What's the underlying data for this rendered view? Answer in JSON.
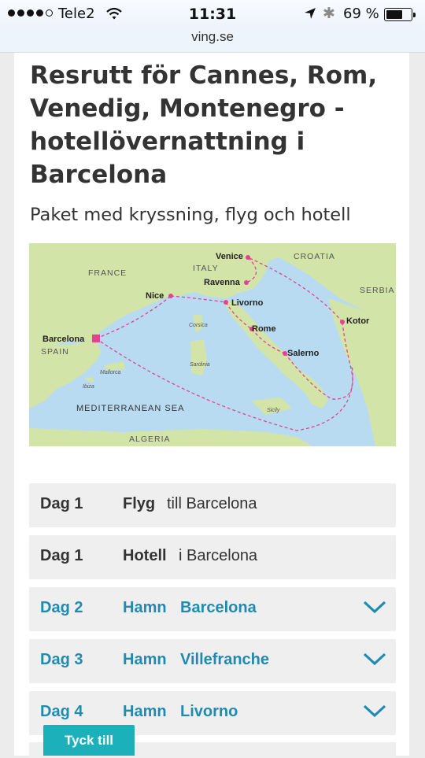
{
  "status_bar": {
    "carrier": "Tele2",
    "time": "11:31",
    "battery": "69 %",
    "battery_level": 0.69,
    "icons": [
      "signal-icon",
      "wifi-icon",
      "location-icon",
      "bluetooth-icon",
      "battery-icon"
    ]
  },
  "browser": {
    "url": "ving.se"
  },
  "page": {
    "title": "Resrutt för Cannes, Rom, Venedig, Montenegro - hotellövernattning i Barcelona",
    "subtitle": "Paket med kryssning, flyg och hotell"
  },
  "map": {
    "countries": [
      "FRANCE",
      "ITALY",
      "CROATIA",
      "SERBIA",
      "SPAIN",
      "ALGERIA"
    ],
    "sea": "MEDITERRANEAN SEA",
    "islands": [
      "Corsica",
      "Sardinia",
      "Mallorca",
      "Ibiza",
      "Sicily"
    ],
    "ports": [
      "Venice",
      "Ravenna",
      "Nice",
      "Livorno",
      "Barcelona",
      "Rome",
      "Salerno",
      "Kotor"
    ],
    "colors": {
      "sea": "#b9dbf1",
      "land": "#d3e4a8",
      "route": "#e0458e"
    }
  },
  "itinerary": [
    {
      "day": "Dag 1",
      "kind": "Flyg",
      "place": "till Barcelona",
      "expandable": false
    },
    {
      "day": "Dag 1",
      "kind": "Hotell",
      "place": "i Barcelona",
      "expandable": false
    },
    {
      "day": "Dag 2",
      "kind": "Hamn",
      "place": "Barcelona",
      "expandable": true
    },
    {
      "day": "Dag 3",
      "kind": "Hamn",
      "place": "Villefranche",
      "expandable": true
    },
    {
      "day": "Dag 4",
      "kind": "Hamn",
      "place": "Livorno",
      "expandable": true
    }
  ],
  "feedback": {
    "label": "Tyck till"
  },
  "colors": {
    "accent": "#1f8bb0",
    "feedback": "#1cb0bb",
    "row_bg": "#efefef"
  }
}
